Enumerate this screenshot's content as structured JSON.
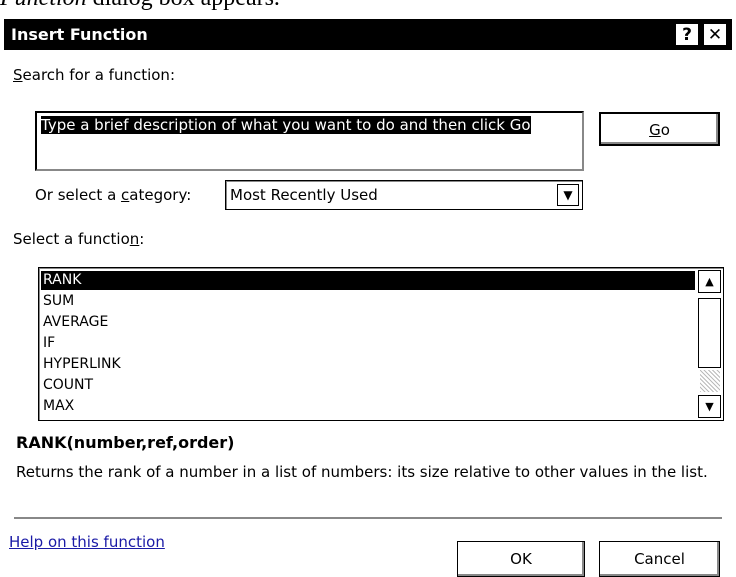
{
  "document_text": {
    "italic": "Function",
    "rest": " dialog box appears."
  },
  "dialog": {
    "title": "Insert Function",
    "help_button": "?",
    "close_button": "✕"
  },
  "search": {
    "label": {
      "u": "S",
      "rest": "earch for a function:"
    },
    "value": "Type a brief description of what you want to do and then click Go",
    "go_button": {
      "u": "G",
      "rest": "o"
    }
  },
  "category": {
    "label": {
      "pre": "Or select a ",
      "u": "c",
      "rest": "ategory:"
    },
    "selected": "Most Recently Used",
    "arrow_icon": "chevron-down-icon"
  },
  "functions": {
    "label": {
      "pre": "Select a functio",
      "u": "n",
      "rest": ":"
    },
    "items": [
      "RANK",
      "SUM",
      "AVERAGE",
      "IF",
      "HYPERLINK",
      "COUNT",
      "MAX"
    ],
    "selected_index": 0
  },
  "selected_function": {
    "signature": "RANK(number,ref,order)",
    "description": "Returns the rank of a number in a list of numbers: its size relative to other values in the list."
  },
  "footer": {
    "help_link": "Help on this function",
    "ok_button": "OK",
    "cancel_button": "Cancel"
  },
  "colors": {
    "selection": "#000000",
    "link": "#1a1aa6",
    "title_bar": "#000000"
  }
}
